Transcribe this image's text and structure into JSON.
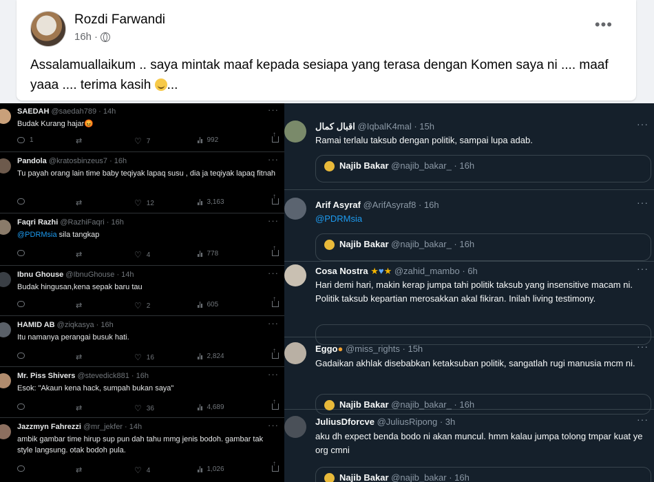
{
  "facebook_post": {
    "author": "Rozdi Farwandi",
    "time": "16h",
    "more": "•••",
    "text": "Assalamuallaikum .. saya mintak maaf kepada sesiapa yang terasa dengan Komen saya ni .... maaf yaaa .... terima kasih",
    "text_suffix": "..."
  },
  "left_tweets": [
    {
      "name": "SAEDAH",
      "handle": "@saedah789 · 14h",
      "text": "Budak Kurang hajar😡",
      "replies": "1",
      "retweets": "",
      "likes": "7",
      "views": "992"
    },
    {
      "name": "Pandola",
      "handle": "@kratosbinzeus7 · 16h",
      "text": "Tu payah orang lain time baby teqiyak lapaq susu  , dia ja teqiyak lapaq fitnah",
      "replies": "",
      "retweets": "",
      "likes": "12",
      "views": "3,163"
    },
    {
      "name": "Faqri Razhi",
      "handle": "@RazhiFaqri · 16h",
      "mention": "@PDRMsia",
      "text": " sila tangkap",
      "replies": "",
      "retweets": "",
      "likes": "4",
      "views": "778"
    },
    {
      "name": "Ibnu Ghouse",
      "handle": "@IbnuGhouse · 14h",
      "text": "Budak hingusan,kena sepak baru tau",
      "replies": "",
      "retweets": "",
      "likes": "2",
      "views": "605"
    },
    {
      "name": "HAMID AB",
      "handle": "@ziqkasya · 16h",
      "text": "Itu namanya perangai busuk hati.",
      "replies": "",
      "retweets": "",
      "likes": "16",
      "views": "2,824"
    },
    {
      "name": "Mr. Piss Shivers",
      "handle": "@stevedick881 · 16h",
      "text": "Esok: \"Akaun kena hack, sumpah bukan saya\"",
      "replies": "",
      "retweets": "",
      "likes": "36",
      "views": "4,689"
    },
    {
      "name": "Jazzmyn Fahrezzi",
      "handle": "@mr_jekfer · 14h",
      "text": "ambik gambar time hirup sup pun dah tahu mmg jenis bodoh. gambar tak style langsung. otak bodoh pula.",
      "replies": "",
      "retweets": "",
      "likes": "4",
      "views": "1,026"
    }
  ],
  "right_tweets": [
    {
      "name": "اقبال كمال",
      "handle": "@IqbalK4mal · 15h",
      "text": "Ramai terlalu taksub dengan politik, sampai lupa adab.",
      "quote_name": "Najib Bakar",
      "quote_handle": "@najib_bakar_ · 16h"
    },
    {
      "name": "Arif Asyraf",
      "handle": "@ArifAsyraf8 · 16h",
      "text": "@PDRMsia",
      "quote_name": "Najib Bakar",
      "quote_handle": "@najib_bakar_ · 16h"
    },
    {
      "name": "Cosa Nostra",
      "handle": "@zahid_mambo · 6h",
      "text": "Hari demi hari, makin kerap jumpa tahi politik taksub yang insensitive macam ni. Politik taksub kepartian merosakkan akal fikiran. Inilah living testimony."
    },
    {
      "name": "Eggo",
      "handle": "@miss_rights · 15h",
      "text": "Gadaikan akhlak disebabkan ketaksuban politik, sangatlah rugi manusia mcm ni.",
      "quote_name": "Najib Bakar",
      "quote_handle": "@najib_bakar_ · 16h"
    },
    {
      "name": "JuliusDforcve",
      "handle": "@JuliusRipong · 3h",
      "text": "aku dh expect benda bodo ni akan muncul. hmm kalau jumpa tolong tmpar kuat ye org cmni",
      "quote_name": "Najib Bakar",
      "quote_handle": "@najib_bakar · 16h"
    }
  ],
  "colors": {
    "mention": "#1d9bf0",
    "left_bg": "#000000",
    "right_bg": "#15202b"
  }
}
